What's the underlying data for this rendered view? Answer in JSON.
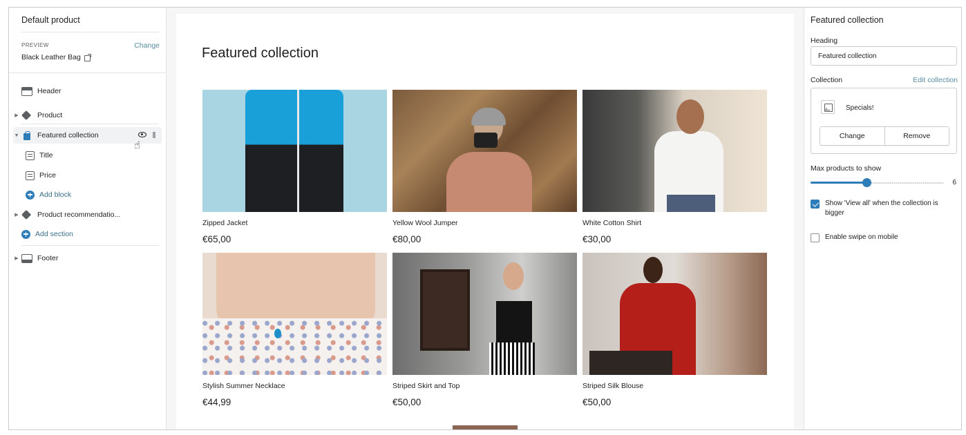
{
  "left_sidebar": {
    "title": "Default product",
    "preview": {
      "label": "PREVIEW",
      "change_label": "Change",
      "value": "Black Leather Bag"
    },
    "tree": [
      {
        "label": "Header",
        "icon": "header-icon"
      },
      {
        "label": "Product",
        "icon": "tag-icon",
        "collapsed": true
      },
      {
        "label": "Featured collection",
        "icon": "bag-icon",
        "expanded": true,
        "selected": true
      },
      {
        "label": "Title",
        "icon": "block-icon"
      },
      {
        "label": "Price",
        "icon": "block-icon"
      },
      {
        "label": "Add block",
        "icon": "plus-circle-icon"
      },
      {
        "label": "Product recommendatio...",
        "icon": "tag-icon",
        "collapsed": true
      },
      {
        "label": "Add section",
        "icon": "plus-circle-icon"
      },
      {
        "label": "Footer",
        "icon": "footer-icon",
        "collapsed": true
      }
    ]
  },
  "canvas": {
    "section_title": "Featured collection",
    "products": [
      {
        "name": "Zipped Jacket",
        "price": "€65,00"
      },
      {
        "name": "Yellow Wool Jumper",
        "price": "€80,00"
      },
      {
        "name": "White Cotton Shirt",
        "price": "€30,00"
      },
      {
        "name": "Stylish Summer Necklace",
        "price": "€44,99"
      },
      {
        "name": "Striped Skirt and Top",
        "price": "€50,00"
      },
      {
        "name": "Striped Silk Blouse",
        "price": "€50,00"
      }
    ],
    "button_color": "#8b6553"
  },
  "right_panel": {
    "title": "Featured collection",
    "heading_label": "Heading",
    "heading_value": "Featured collection",
    "collection_label": "Collection",
    "edit_collection": "Edit collection",
    "collection_name": "Specials!",
    "change_button": "Change",
    "remove_button": "Remove",
    "max_products_label": "Max products to show",
    "max_products_value": "6",
    "max_products_fraction": 0.42,
    "view_all_label": "Show 'View all' when the collection is bigger",
    "view_all_checked": true,
    "swipe_label": "Enable swipe on mobile",
    "swipe_checked": false
  },
  "colors": {
    "accent": "#2e7cb8",
    "link": "#5a8ca0"
  }
}
